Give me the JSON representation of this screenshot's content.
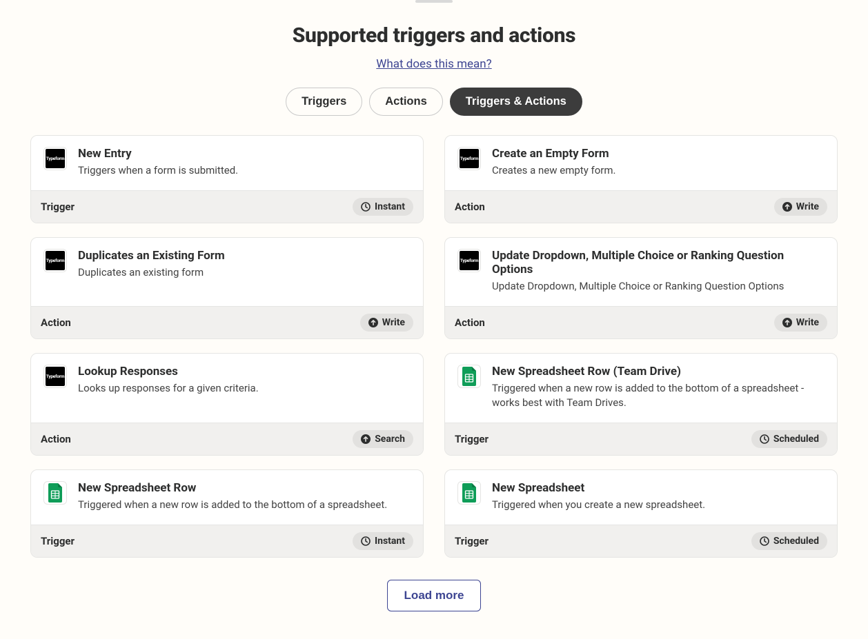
{
  "header": {
    "title": "Supported triggers and actions",
    "help_link": "What does this mean?"
  },
  "tabs": {
    "triggers": "Triggers",
    "actions": "Actions",
    "both": "Triggers & Actions"
  },
  "badges": {
    "instant": "Instant",
    "write": "Write",
    "search": "Search",
    "scheduled": "Scheduled"
  },
  "footer_types": {
    "trigger": "Trigger",
    "action": "Action"
  },
  "icons": {
    "typeform_text": "Typeform"
  },
  "cards": [
    {
      "app": "typeform",
      "title": "New Entry",
      "desc": "Triggers when a form is submitted.",
      "type": "trigger",
      "badge": "instant"
    },
    {
      "app": "typeform",
      "title": "Create an Empty Form",
      "desc": "Creates a new empty form.",
      "type": "action",
      "badge": "write"
    },
    {
      "app": "typeform",
      "title": "Duplicates an Existing Form",
      "desc": "Duplicates an existing form",
      "type": "action",
      "badge": "write"
    },
    {
      "app": "typeform",
      "title": "Update Dropdown, Multiple Choice or Ranking Question Options",
      "desc": "Update Dropdown, Multiple Choice or Ranking Question Options",
      "type": "action",
      "badge": "write"
    },
    {
      "app": "typeform",
      "title": "Lookup Responses",
      "desc": "Looks up responses for a given criteria.",
      "type": "action",
      "badge": "search"
    },
    {
      "app": "sheets",
      "title": "New Spreadsheet Row (Team Drive)",
      "desc": "Triggered when a new row is added to the bottom of a spreadsheet - works best with Team Drives.",
      "type": "trigger",
      "badge": "scheduled"
    },
    {
      "app": "sheets",
      "title": "New Spreadsheet Row",
      "desc": "Triggered when a new row is added to the bottom of a spreadsheet.",
      "type": "trigger",
      "badge": "instant"
    },
    {
      "app": "sheets",
      "title": "New Spreadsheet",
      "desc": "Triggered when you create a new spreadsheet.",
      "type": "trigger",
      "badge": "scheduled"
    }
  ],
  "load_more": "Load more"
}
